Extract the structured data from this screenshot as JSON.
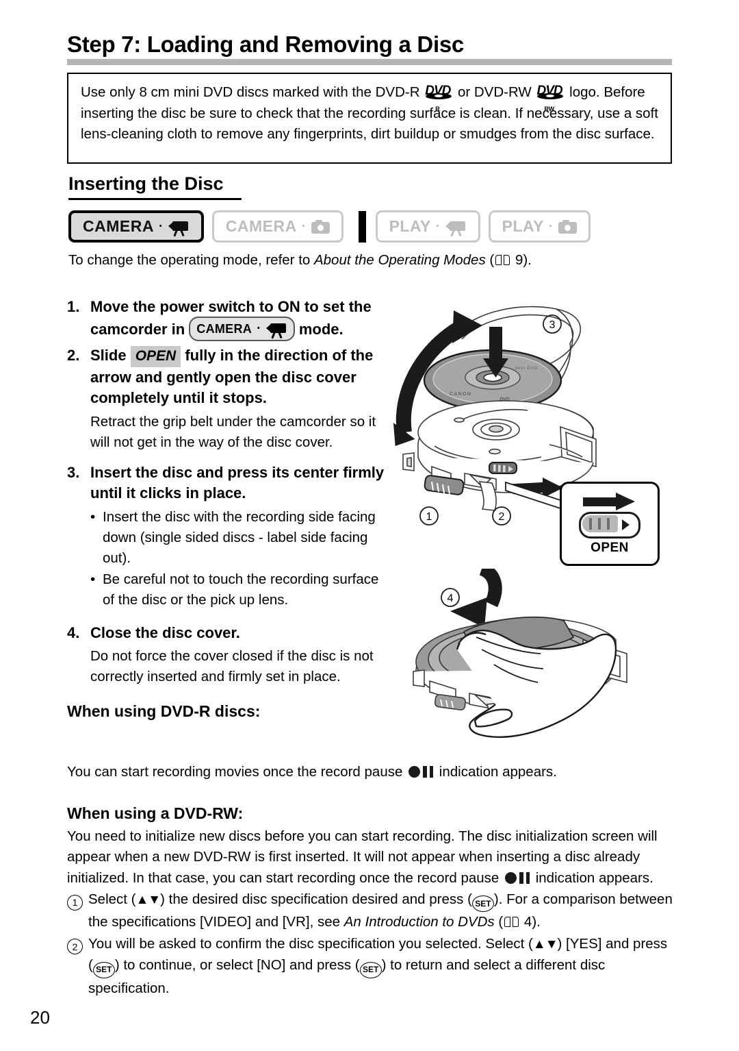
{
  "page": {
    "number": "20",
    "title": "Step 7: Loading and Removing a Disc"
  },
  "notebox": {
    "text_part1": "Use only 8 cm mini DVD discs marked with the DVD-R ",
    "logo1": "DVD",
    "logo1_sub": "R",
    "text_part2": " or DVD-RW ",
    "logo2": "DVD",
    "logo2_sub": "RW",
    "text_part3": " logo. Before inserting the disc be sure to check that the recording surface is clean. If necessary, use a soft lens-cleaning cloth to remove any fingerprints, dirt buildup or smudges from the disc surface."
  },
  "section": {
    "heading": "Inserting the Disc",
    "modes": [
      {
        "label": "CAMERA",
        "icon": "movie-camera-icon",
        "active": true
      },
      {
        "label": "CAMERA",
        "icon": "still-camera-icon",
        "active": false
      },
      {
        "label": "PLAY",
        "icon": "movie-camera-icon",
        "active": false
      },
      {
        "label": "PLAY",
        "icon": "still-camera-icon",
        "active": false
      }
    ],
    "mode_note_before": "To change the operating mode, refer to ",
    "mode_note_italic": "About the Operating Modes",
    "mode_note_after_open": " (",
    "mode_note_page": "9",
    "mode_note_close": ")."
  },
  "steps": {
    "s1_num": "1.",
    "s1_a": "Move the power switch to ON to set the camcorder in ",
    "s1_badge": "CAMERA",
    "s1_b": " mode.",
    "s2_num": "2.",
    "s2_a": "Slide ",
    "s2_open": "OPEN",
    "s2_b": " fully in the direction of the arrow and gently open the disc cover completely until it stops.",
    "s2_sub": "Retract the grip belt under the camcorder so it will not get in the way of the disc cover.",
    "s3_num": "3.",
    "s3_a": "Insert the disc and press its center firmly until it clicks in place.",
    "s3_b1": "Insert the disc with the recording side facing down (single sided discs - label side facing out).",
    "s3_b2": "Be careful not to touch the recording surface of the disc or the pick up lens.",
    "s4_num": "4.",
    "s4_a": "Close the disc cover.",
    "s4_sub": "Do not force the cover closed if the disc is not correctly inserted and firmly set in place.",
    "bullet": "•"
  },
  "dvdr": {
    "heading": "When using DVD-R discs:",
    "body_a": "You can start recording movies once the record pause ",
    "body_b": " indication appears."
  },
  "dvdrw": {
    "heading": "When using a DVD-RW:",
    "body_a": "You need to initialize new discs before you can start recording. The disc initialization screen will appear when a new DVD-RW is first inserted. It will not appear when inserting a disc already initialized. In that case, you can start recording once the record pause ",
    "body_b": " indication appears.",
    "item1_num": "1",
    "item1_a": "Select (",
    "item1_arrows": "▲▼",
    "item1_b": ") the desired disc specification desired and press (",
    "item1_set": "SET",
    "item1_c": "). For a comparison between the specifications [VIDEO] and [VR], see ",
    "item1_italic": "An Introduction to DVDs",
    "item1_d": " (",
    "item1_page": "4",
    "item1_e": ").",
    "item2_num": "2",
    "item2_a": "You will be asked to confirm the disc specification you selected. Select (",
    "item2_arrows": "▲▼",
    "item2_b": ") [YES] and press (",
    "item2_set": "SET",
    "item2_c": ") to continue, or select [NO] and press (",
    "item2_set2": "SET",
    "item2_d": ") to return and select a different disc specification."
  },
  "illustration": {
    "callout_open_label": "OPEN",
    "marker1": "1",
    "marker2": "2",
    "marker3": "3",
    "marker4": "4",
    "disc_brand": "CANON",
    "disc_logo": "DVD"
  }
}
